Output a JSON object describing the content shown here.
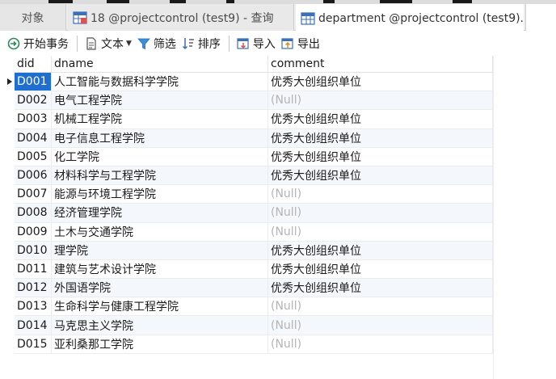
{
  "tabs": {
    "objects": "对象",
    "query": "18 @projectcontrol (test9) - 查询",
    "department": "department @projectcontrol (test9)..."
  },
  "toolbar": {
    "begin_transaction": "开始事务",
    "text": "文本",
    "filter": "筛选",
    "sort": "排序",
    "import": "导入",
    "export": "导出"
  },
  "table": {
    "columns": [
      "did",
      "dname",
      "comment"
    ],
    "null_text": "(Null)",
    "rows": [
      {
        "did": "D001",
        "dname": "人工智能与数据科学学院",
        "comment": "优秀大创组织单位"
      },
      {
        "did": "D002",
        "dname": "电气工程学院",
        "comment": "(Null)"
      },
      {
        "did": "D003",
        "dname": "机械工程学院",
        "comment": "优秀大创组织单位"
      },
      {
        "did": "D004",
        "dname": "电子信息工程学院",
        "comment": "优秀大创组织单位"
      },
      {
        "did": "D005",
        "dname": "化工学院",
        "comment": "优秀大创组织单位"
      },
      {
        "did": "D006",
        "dname": "材料科学与工程学院",
        "comment": "优秀大创组织单位"
      },
      {
        "did": "D007",
        "dname": "能源与环境工程学院",
        "comment": "(Null)"
      },
      {
        "did": "D008",
        "dname": "经济管理学院",
        "comment": "(Null)"
      },
      {
        "did": "D009",
        "dname": "土木与交通学院",
        "comment": "(Null)"
      },
      {
        "did": "D010",
        "dname": "理学院",
        "comment": "优秀大创组织单位"
      },
      {
        "did": "D011",
        "dname": "建筑与艺术设计学院",
        "comment": "优秀大创组织单位"
      },
      {
        "did": "D012",
        "dname": "外国语学院",
        "comment": "优秀大创组织单位"
      },
      {
        "did": "D013",
        "dname": "生命科学与健康工程学院",
        "comment": "(Null)"
      },
      {
        "did": "D014",
        "dname": "马克思主义学院",
        "comment": "(Null)"
      },
      {
        "did": "D015",
        "dname": "亚利桑那工学院",
        "comment": "(Null)"
      }
    ]
  },
  "colors": {
    "selected_cell": "#1e6fd0",
    "null_text": "#b4b4b4",
    "alt_row": "#f4f7fb"
  }
}
